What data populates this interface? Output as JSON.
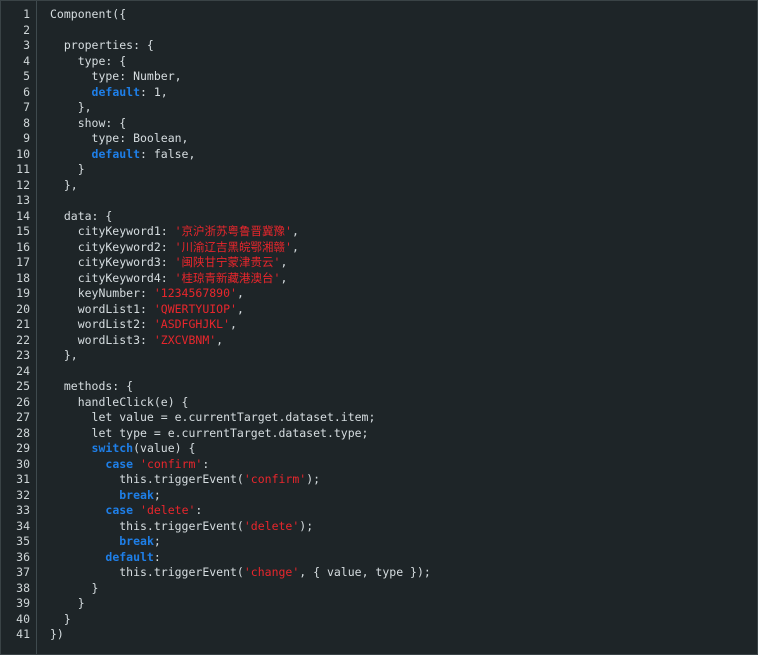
{
  "editor": {
    "lines": [
      [
        {
          "t": "plain",
          "v": "Component({"
        }
      ],
      [
        {
          "t": "plain",
          "v": ""
        }
      ],
      [
        {
          "t": "plain",
          "v": "  properties: {"
        }
      ],
      [
        {
          "t": "plain",
          "v": "    type: {"
        }
      ],
      [
        {
          "t": "plain",
          "v": "      type: Number,"
        }
      ],
      [
        {
          "t": "plain",
          "v": "      "
        },
        {
          "t": "kw",
          "v": "default"
        },
        {
          "t": "plain",
          "v": ": 1,"
        }
      ],
      [
        {
          "t": "plain",
          "v": "    },"
        }
      ],
      [
        {
          "t": "plain",
          "v": "    show: {"
        }
      ],
      [
        {
          "t": "plain",
          "v": "      type: Boolean,"
        }
      ],
      [
        {
          "t": "plain",
          "v": "      "
        },
        {
          "t": "kw",
          "v": "default"
        },
        {
          "t": "plain",
          "v": ": false,"
        }
      ],
      [
        {
          "t": "plain",
          "v": "    }"
        }
      ],
      [
        {
          "t": "plain",
          "v": "  },"
        }
      ],
      [
        {
          "t": "plain",
          "v": ""
        }
      ],
      [
        {
          "t": "plain",
          "v": "  data: {"
        }
      ],
      [
        {
          "t": "plain",
          "v": "    cityKeyword1: "
        },
        {
          "t": "str",
          "v": "'京沪浙苏粤鲁晋冀豫'"
        },
        {
          "t": "plain",
          "v": ","
        }
      ],
      [
        {
          "t": "plain",
          "v": "    cityKeyword2: "
        },
        {
          "t": "str",
          "v": "'川渝辽吉黑皖鄂湘赣'"
        },
        {
          "t": "plain",
          "v": ","
        }
      ],
      [
        {
          "t": "plain",
          "v": "    cityKeyword3: "
        },
        {
          "t": "str",
          "v": "'闽陕甘宁蒙津贵云'"
        },
        {
          "t": "plain",
          "v": ","
        }
      ],
      [
        {
          "t": "plain",
          "v": "    cityKeyword4: "
        },
        {
          "t": "str",
          "v": "'桂琼青新藏港澳台'"
        },
        {
          "t": "plain",
          "v": ","
        }
      ],
      [
        {
          "t": "plain",
          "v": "    keyNumber: "
        },
        {
          "t": "str",
          "v": "'1234567890'"
        },
        {
          "t": "plain",
          "v": ","
        }
      ],
      [
        {
          "t": "plain",
          "v": "    wordList1: "
        },
        {
          "t": "str",
          "v": "'QWERTYUIOP'"
        },
        {
          "t": "plain",
          "v": ","
        }
      ],
      [
        {
          "t": "plain",
          "v": "    wordList2: "
        },
        {
          "t": "str",
          "v": "'ASDFGHJKL'"
        },
        {
          "t": "plain",
          "v": ","
        }
      ],
      [
        {
          "t": "plain",
          "v": "    wordList3: "
        },
        {
          "t": "str",
          "v": "'ZXCVBNM'"
        },
        {
          "t": "plain",
          "v": ","
        }
      ],
      [
        {
          "t": "plain",
          "v": "  },"
        }
      ],
      [
        {
          "t": "plain",
          "v": ""
        }
      ],
      [
        {
          "t": "plain",
          "v": "  methods: {"
        }
      ],
      [
        {
          "t": "plain",
          "v": "    handleClick(e) {"
        }
      ],
      [
        {
          "t": "plain",
          "v": "      let value = e.currentTarget.dataset.item;"
        }
      ],
      [
        {
          "t": "plain",
          "v": "      let type = e.currentTarget.dataset.type;"
        }
      ],
      [
        {
          "t": "plain",
          "v": "      "
        },
        {
          "t": "kw",
          "v": "switch"
        },
        {
          "t": "plain",
          "v": "(value) {"
        }
      ],
      [
        {
          "t": "plain",
          "v": "        "
        },
        {
          "t": "kw",
          "v": "case"
        },
        {
          "t": "plain",
          "v": " "
        },
        {
          "t": "str",
          "v": "'confirm'"
        },
        {
          "t": "plain",
          "v": ":"
        }
      ],
      [
        {
          "t": "plain",
          "v": "          this.triggerEvent("
        },
        {
          "t": "str",
          "v": "'confirm'"
        },
        {
          "t": "plain",
          "v": ");"
        }
      ],
      [
        {
          "t": "plain",
          "v": "          "
        },
        {
          "t": "kw",
          "v": "break"
        },
        {
          "t": "plain",
          "v": ";"
        }
      ],
      [
        {
          "t": "plain",
          "v": "        "
        },
        {
          "t": "kw",
          "v": "case"
        },
        {
          "t": "plain",
          "v": " "
        },
        {
          "t": "str",
          "v": "'delete'"
        },
        {
          "t": "plain",
          "v": ":"
        }
      ],
      [
        {
          "t": "plain",
          "v": "          this.triggerEvent("
        },
        {
          "t": "str",
          "v": "'delete'"
        },
        {
          "t": "plain",
          "v": ");"
        }
      ],
      [
        {
          "t": "plain",
          "v": "          "
        },
        {
          "t": "kw",
          "v": "break"
        },
        {
          "t": "plain",
          "v": ";"
        }
      ],
      [
        {
          "t": "plain",
          "v": "        "
        },
        {
          "t": "kw",
          "v": "default"
        },
        {
          "t": "plain",
          "v": ":"
        }
      ],
      [
        {
          "t": "plain",
          "v": "          this.triggerEvent("
        },
        {
          "t": "str",
          "v": "'change'"
        },
        {
          "t": "plain",
          "v": ", { value, type });"
        }
      ],
      [
        {
          "t": "plain",
          "v": "      }"
        }
      ],
      [
        {
          "t": "plain",
          "v": "    }"
        }
      ],
      [
        {
          "t": "plain",
          "v": "  }"
        }
      ],
      [
        {
          "t": "plain",
          "v": "})"
        }
      ]
    ]
  }
}
